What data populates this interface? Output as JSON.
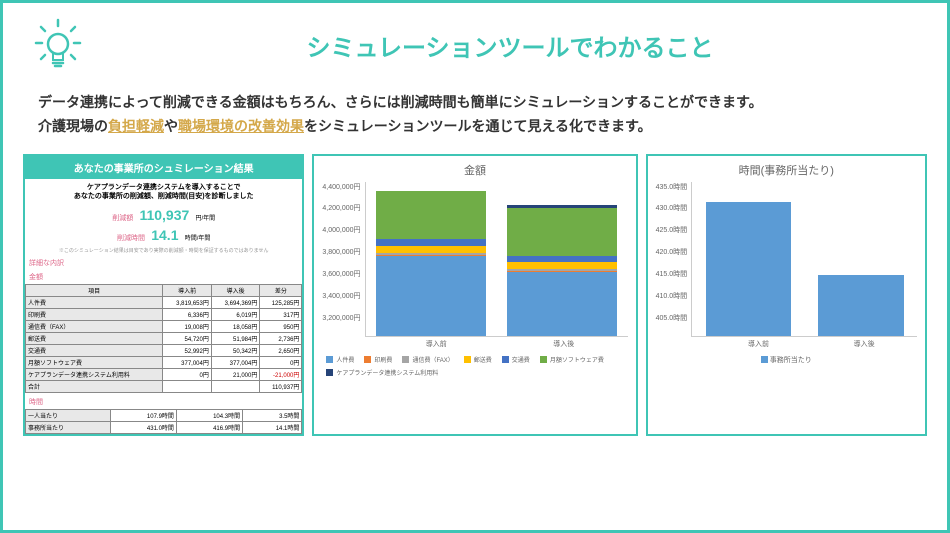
{
  "header": {
    "title": "シミュレーションツールでわかること"
  },
  "desc": {
    "l1": "データ連携によって削減できる金額はもちろん、さらには削減時間も簡単にシミュレーションすることができます。",
    "l2a": "介護現場の",
    "hl1": "負担軽減",
    "l2b": "や",
    "hl2": "職場環境の改善効果",
    "l2c": "をシミュレーションツールを通じて見える化できます。"
  },
  "sim": {
    "header": "あなたの事業所のシュミレーション結果",
    "sub1": "ケアプランデータ連携システムを導入することで",
    "sub2": "あなたの事業所の削減額、削減時間(目安)を診断しました",
    "lbl1": "削減額",
    "val1": "110,937",
    "unit1": "円/年間",
    "lbl2": "削減時間",
    "val2": "14.1",
    "unit2": "時間/年間",
    "detail": "詳細な内訳",
    "sec1": "金額",
    "cols": [
      "項目",
      "導入前",
      "導入後",
      "差分"
    ],
    "rows": [
      [
        "人件費",
        "3,819,653円",
        "3,694,369円",
        "125,285円"
      ],
      [
        "印刷費",
        "6,336円",
        "6,019円",
        "317円"
      ],
      [
        "通信費（FAX）",
        "19,008円",
        "18,058円",
        "950円"
      ],
      [
        "郵送費",
        "54,720円",
        "51,984円",
        "2,736円"
      ],
      [
        "交通費",
        "52,992円",
        "50,342円",
        "2,650円"
      ],
      [
        "月額ソフトウェア費",
        "377,004円",
        "377,004円",
        "0円"
      ],
      [
        "ケアプランデータ連携システム利用料",
        "0円",
        "21,000円",
        "-21,000円"
      ],
      [
        "合計",
        "",
        "",
        "110,937円"
      ]
    ],
    "sec2": "時間",
    "trows": [
      [
        "一人当たり",
        "107.9時間",
        "104.3時間",
        "3.5時間"
      ],
      [
        "事務所当たり",
        "431.0時間",
        "416.9時間",
        "14.1時間"
      ]
    ]
  },
  "chart_data": [
    {
      "type": "bar",
      "stacked": true,
      "title": "金額",
      "categories": [
        "導入前",
        "導入後"
      ],
      "series": [
        {
          "name": "人件費",
          "color": "#5b9bd5",
          "values": [
            3819653,
            3694369
          ]
        },
        {
          "name": "印刷費",
          "color": "#ed7d31",
          "values": [
            6336,
            6019
          ]
        },
        {
          "name": "通信費（FAX）",
          "color": "#a5a5a5",
          "values": [
            19008,
            18058
          ]
        },
        {
          "name": "郵送費",
          "color": "#ffc000",
          "values": [
            54720,
            51984
          ]
        },
        {
          "name": "交通費",
          "color": "#4472c4",
          "values": [
            52992,
            50342
          ]
        },
        {
          "name": "月額ソフトウェア費",
          "color": "#70ad47",
          "values": [
            377004,
            377004
          ]
        },
        {
          "name": "ケアプランデータ連携システム利用料",
          "color": "#264478",
          "values": [
            0,
            21000
          ]
        }
      ],
      "ylabel": "",
      "ylim": [
        3200000,
        4400000
      ],
      "yticks": [
        "4,400,000円",
        "4,200,000円",
        "4,000,000円",
        "3,800,000円",
        "3,600,000円",
        "3,400,000円",
        "3,200,000円"
      ]
    },
    {
      "type": "bar",
      "title": "時間(事務所当たり)",
      "categories": [
        "導入前",
        "導入後"
      ],
      "series": [
        {
          "name": "事務所当たり",
          "color": "#5b9bd5",
          "values": [
            431.0,
            416.9
          ]
        }
      ],
      "ylim": [
        405,
        435
      ],
      "yticks": [
        "435.0時間",
        "430.0時間",
        "425.0時間",
        "420.0時間",
        "415.0時間",
        "410.0時間",
        "405.0時間"
      ]
    }
  ]
}
